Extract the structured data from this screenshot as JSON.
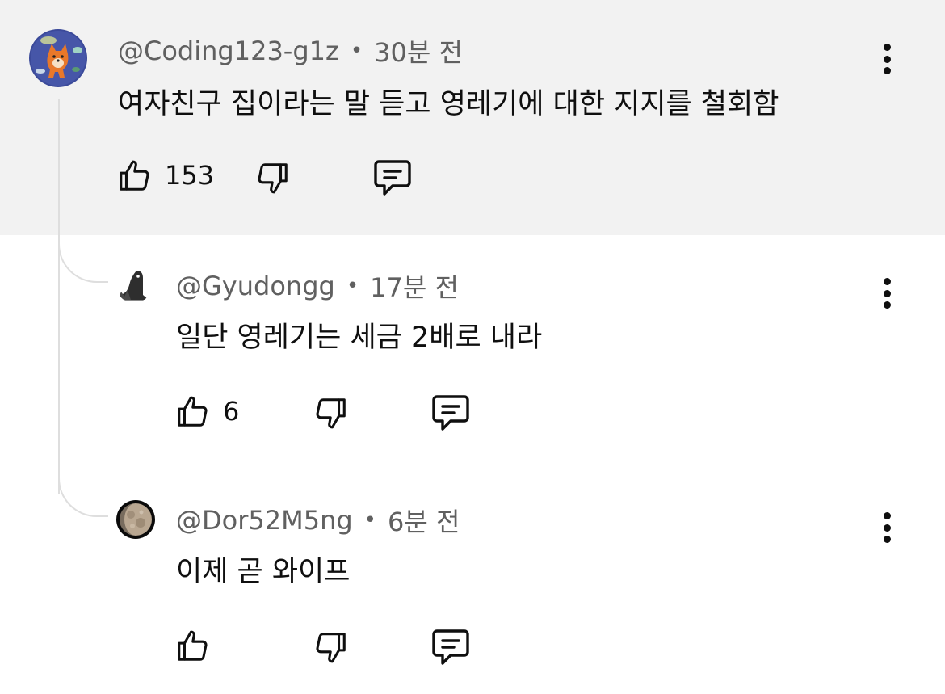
{
  "comments": [
    {
      "author": "@Coding123-g1z",
      "time": "30분 전",
      "text": "여자친구 집이라는 말 듣고 영레기에 대한 지지를 철회함",
      "likes": "153",
      "avatar_icon": "shiba-dog-avatar"
    },
    {
      "author": "@Gyudongg",
      "time": "17분 전",
      "text": "일단 영레기는 세금 2배로 내라",
      "likes": "6",
      "avatar_icon": "bird-silhouette-avatar"
    },
    {
      "author": "@Dor52M5ng",
      "time": "6분 전",
      "text": "이제 곧 와이프",
      "likes": "",
      "avatar_icon": "moon-avatar"
    }
  ],
  "separator": "•",
  "colors": {
    "highlight_bg": "#f2f2f2",
    "text": "#0f0f0f",
    "meta": "#606060",
    "thread_line": "#dedede"
  }
}
